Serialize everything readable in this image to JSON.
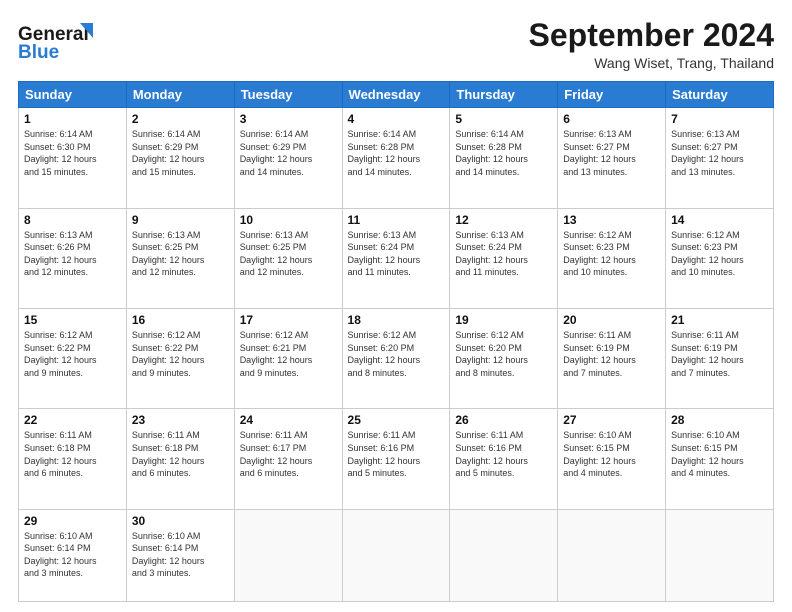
{
  "header": {
    "logo_line1": "General",
    "logo_line2": "Blue",
    "month_title": "September 2024",
    "location": "Wang Wiset, Trang, Thailand"
  },
  "days_of_week": [
    "Sunday",
    "Monday",
    "Tuesday",
    "Wednesday",
    "Thursday",
    "Friday",
    "Saturday"
  ],
  "weeks": [
    [
      {
        "day": "1",
        "sunrise": "6:14 AM",
        "sunset": "6:30 PM",
        "daylight": "12 hours and 15 minutes."
      },
      {
        "day": "2",
        "sunrise": "6:14 AM",
        "sunset": "6:29 PM",
        "daylight": "12 hours and 15 minutes."
      },
      {
        "day": "3",
        "sunrise": "6:14 AM",
        "sunset": "6:29 PM",
        "daylight": "12 hours and 14 minutes."
      },
      {
        "day": "4",
        "sunrise": "6:14 AM",
        "sunset": "6:28 PM",
        "daylight": "12 hours and 14 minutes."
      },
      {
        "day": "5",
        "sunrise": "6:14 AM",
        "sunset": "6:28 PM",
        "daylight": "12 hours and 14 minutes."
      },
      {
        "day": "6",
        "sunrise": "6:13 AM",
        "sunset": "6:27 PM",
        "daylight": "12 hours and 13 minutes."
      },
      {
        "day": "7",
        "sunrise": "6:13 AM",
        "sunset": "6:27 PM",
        "daylight": "12 hours and 13 minutes."
      }
    ],
    [
      {
        "day": "8",
        "sunrise": "6:13 AM",
        "sunset": "6:26 PM",
        "daylight": "12 hours and 12 minutes."
      },
      {
        "day": "9",
        "sunrise": "6:13 AM",
        "sunset": "6:25 PM",
        "daylight": "12 hours and 12 minutes."
      },
      {
        "day": "10",
        "sunrise": "6:13 AM",
        "sunset": "6:25 PM",
        "daylight": "12 hours and 12 minutes."
      },
      {
        "day": "11",
        "sunrise": "6:13 AM",
        "sunset": "6:24 PM",
        "daylight": "12 hours and 11 minutes."
      },
      {
        "day": "12",
        "sunrise": "6:13 AM",
        "sunset": "6:24 PM",
        "daylight": "12 hours and 11 minutes."
      },
      {
        "day": "13",
        "sunrise": "6:12 AM",
        "sunset": "6:23 PM",
        "daylight": "12 hours and 10 minutes."
      },
      {
        "day": "14",
        "sunrise": "6:12 AM",
        "sunset": "6:23 PM",
        "daylight": "12 hours and 10 minutes."
      }
    ],
    [
      {
        "day": "15",
        "sunrise": "6:12 AM",
        "sunset": "6:22 PM",
        "daylight": "12 hours and 9 minutes."
      },
      {
        "day": "16",
        "sunrise": "6:12 AM",
        "sunset": "6:22 PM",
        "daylight": "12 hours and 9 minutes."
      },
      {
        "day": "17",
        "sunrise": "6:12 AM",
        "sunset": "6:21 PM",
        "daylight": "12 hours and 9 minutes."
      },
      {
        "day": "18",
        "sunrise": "6:12 AM",
        "sunset": "6:20 PM",
        "daylight": "12 hours and 8 minutes."
      },
      {
        "day": "19",
        "sunrise": "6:12 AM",
        "sunset": "6:20 PM",
        "daylight": "12 hours and 8 minutes."
      },
      {
        "day": "20",
        "sunrise": "6:11 AM",
        "sunset": "6:19 PM",
        "daylight": "12 hours and 7 minutes."
      },
      {
        "day": "21",
        "sunrise": "6:11 AM",
        "sunset": "6:19 PM",
        "daylight": "12 hours and 7 minutes."
      }
    ],
    [
      {
        "day": "22",
        "sunrise": "6:11 AM",
        "sunset": "6:18 PM",
        "daylight": "12 hours and 6 minutes."
      },
      {
        "day": "23",
        "sunrise": "6:11 AM",
        "sunset": "6:18 PM",
        "daylight": "12 hours and 6 minutes."
      },
      {
        "day": "24",
        "sunrise": "6:11 AM",
        "sunset": "6:17 PM",
        "daylight": "12 hours and 6 minutes."
      },
      {
        "day": "25",
        "sunrise": "6:11 AM",
        "sunset": "6:16 PM",
        "daylight": "12 hours and 5 minutes."
      },
      {
        "day": "26",
        "sunrise": "6:11 AM",
        "sunset": "6:16 PM",
        "daylight": "12 hours and 5 minutes."
      },
      {
        "day": "27",
        "sunrise": "6:10 AM",
        "sunset": "6:15 PM",
        "daylight": "12 hours and 4 minutes."
      },
      {
        "day": "28",
        "sunrise": "6:10 AM",
        "sunset": "6:15 PM",
        "daylight": "12 hours and 4 minutes."
      }
    ],
    [
      {
        "day": "29",
        "sunrise": "6:10 AM",
        "sunset": "6:14 PM",
        "daylight": "12 hours and 3 minutes."
      },
      {
        "day": "30",
        "sunrise": "6:10 AM",
        "sunset": "6:14 PM",
        "daylight": "12 hours and 3 minutes."
      },
      null,
      null,
      null,
      null,
      null
    ]
  ]
}
